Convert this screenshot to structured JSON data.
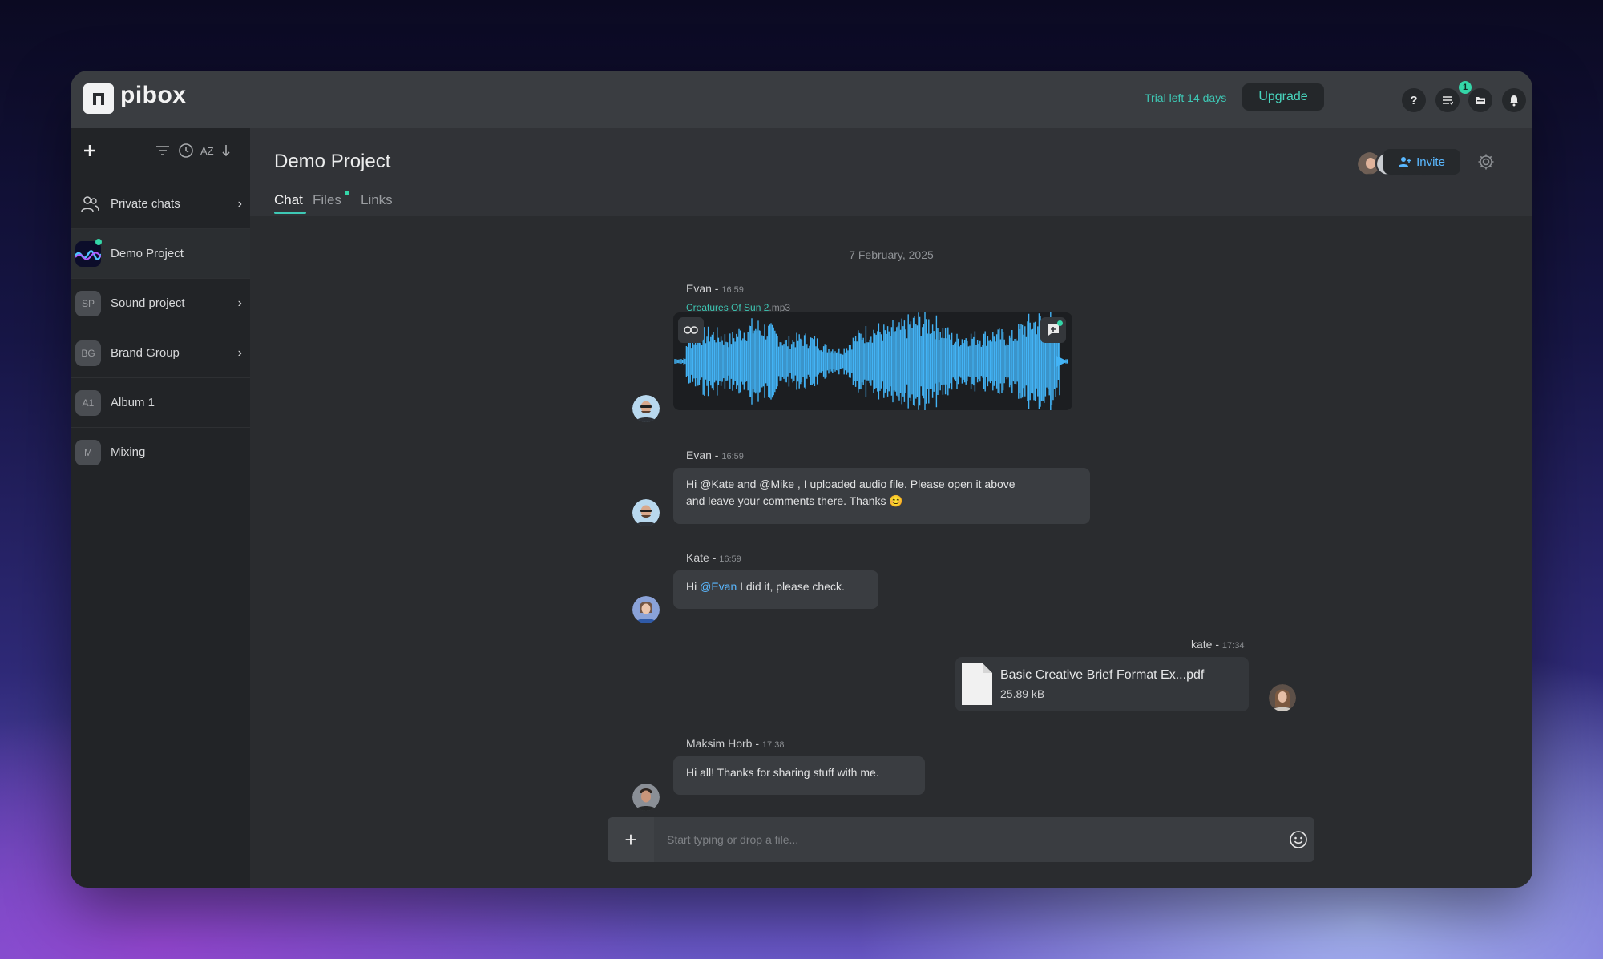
{
  "app": {
    "name": "pibox"
  },
  "topbar": {
    "trial_text": "Trial left 14 days",
    "upgrade_label": "Upgrade",
    "help_label": "?",
    "notification_count": "1"
  },
  "sidebar": {
    "items": [
      {
        "label": "Private chats",
        "badge": "",
        "has_chevron": true
      },
      {
        "label": "Demo Project",
        "badge": "",
        "has_chevron": false
      },
      {
        "label": "Sound project",
        "badge": "SP",
        "has_chevron": true
      },
      {
        "label": "Brand Group",
        "badge": "BG",
        "has_chevron": true
      },
      {
        "label": "Album 1",
        "badge": "A1",
        "has_chevron": false
      },
      {
        "label": "Mixing",
        "badge": "M",
        "has_chevron": false
      }
    ]
  },
  "project": {
    "title": "Demo Project",
    "tabs": [
      {
        "label": "Chat",
        "active": true
      },
      {
        "label": "Files",
        "active": false
      },
      {
        "label": "Links",
        "active": false
      }
    ],
    "invite_label": "Invite"
  },
  "chat": {
    "date": "7 February, 2025",
    "messages": [
      {
        "author": "Evan - ",
        "time": "16:59",
        "file_name": "Creatures Of Sun 2",
        "file_ext": ".mp3"
      },
      {
        "author": "Evan - ",
        "time": "16:59",
        "text_line1": "Hi @Kate and @Mike , I uploaded audio file. Please open it above",
        "text_line2": "and leave your comments there. Thanks 😊"
      },
      {
        "author": "Kate - ",
        "time": "16:59",
        "text_pre": "Hi ",
        "mention": "@Evan",
        "text_post": " I did it, please check."
      },
      {
        "author": "kate - ",
        "time": "17:34",
        "file_title": "Basic Creative Brief Format Ex...pdf",
        "file_size": "25.89 kB"
      },
      {
        "author": "Maksim Horb - ",
        "time": "17:38",
        "text": "Hi all! Thanks for sharing stuff with me."
      }
    ]
  },
  "composer": {
    "placeholder": "Start typing or drop a file...",
    "plus_label": "+"
  },
  "colors": {
    "accent_teal": "#3ec8b5",
    "accent_blue": "#5ab8ff",
    "waveform": "#43b3f5",
    "panel": "#2a2c2f"
  }
}
